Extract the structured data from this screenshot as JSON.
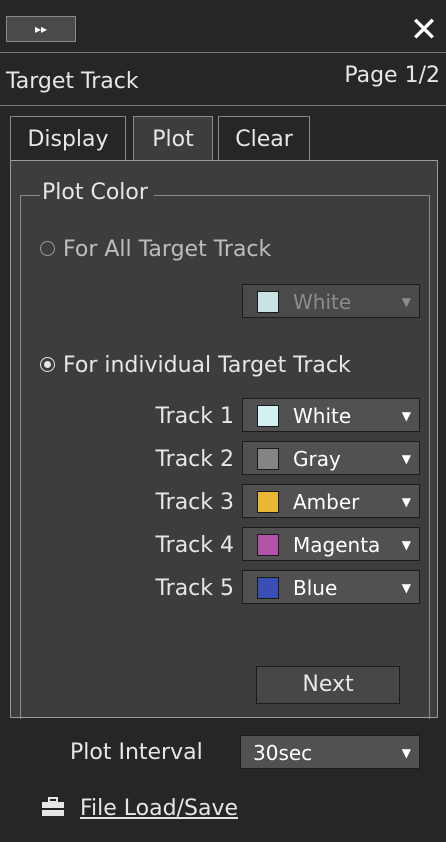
{
  "header": {
    "collapse_glyph": "▸▸",
    "close_glyph": "✕",
    "title": "Target Track",
    "page": "Page 1/2"
  },
  "tabs": [
    {
      "label": "Display",
      "active": false
    },
    {
      "label": "Plot",
      "active": true
    },
    {
      "label": "Clear",
      "active": false
    }
  ],
  "plot_color": {
    "legend": "Plot Color",
    "all_option": {
      "label": "For All Target Track",
      "selected": false,
      "color_value": "White",
      "color_hex": "#d3f1f2"
    },
    "individual_option": {
      "label": "For individual Target Track",
      "selected": true
    },
    "tracks": [
      {
        "label": "Track 1",
        "color": "White",
        "hex": "#d3f1f2"
      },
      {
        "label": "Track 2",
        "color": "Gray",
        "hex": "#858585"
      },
      {
        "label": "Track 3",
        "color": "Amber",
        "hex": "#e8b733"
      },
      {
        "label": "Track 4",
        "color": "Magenta",
        "hex": "#b452a8"
      },
      {
        "label": "Track 5",
        "color": "Blue",
        "hex": "#3a4fb5"
      }
    ],
    "next_label": "Next"
  },
  "plot_interval": {
    "label": "Plot Interval",
    "value": "30sec"
  },
  "file": {
    "label": "File Load/Save",
    "icon": "briefcase-icon"
  },
  "colors": {
    "panel_bg": "#3d3d3d",
    "window_bg": "#262626",
    "text": "#e6e6e6"
  }
}
